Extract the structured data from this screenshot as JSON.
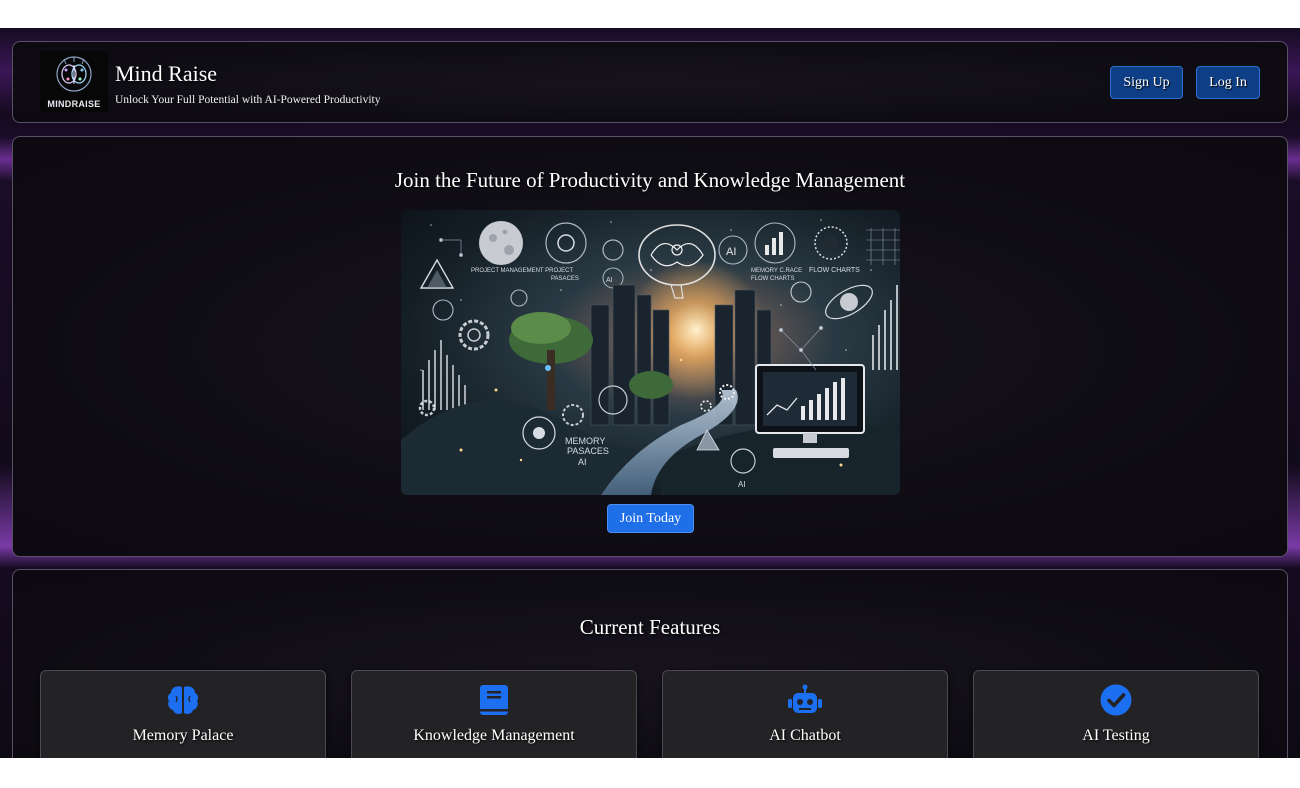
{
  "header": {
    "logo_text": "MINDRAISE",
    "brand_name": "Mind Raise",
    "tagline": "Unlock Your Full Potential with AI-Powered Productivity",
    "signup_label": "Sign Up",
    "login_label": "Log In"
  },
  "hero": {
    "title": "Join the Future of Productivity and Knowledge Management",
    "image_labels": {
      "project": "PROJECT MANAGEMENT PROJECT",
      "pasaces": "PASACES",
      "ai_top": "AI",
      "ai_small": "AI",
      "memory_c": "MEMORY C.RACE",
      "flow_charts_a": "FLOW CHARTS",
      "flow_charts_b": "FLOW CHARTS",
      "memory_pasaces_line1": "MEMORY",
      "memory_pasaces_line2": "PASACES",
      "memory_pasaces_line3": "AI",
      "ai_bottom": "AI"
    },
    "cta_label": "Join Today"
  },
  "features": {
    "title": "Current Features",
    "cards": [
      {
        "title": "Memory Palace",
        "icon": "brain-icon"
      },
      {
        "title": "Knowledge Management",
        "icon": "book-icon"
      },
      {
        "title": "AI Chatbot",
        "icon": "robot-icon"
      },
      {
        "title": "AI Testing",
        "icon": "check-circle-icon"
      }
    ]
  },
  "colors": {
    "accent_blue": "#1f6fe8",
    "header_button": "#0e3f86",
    "purple_glow": "#6a2e90"
  }
}
